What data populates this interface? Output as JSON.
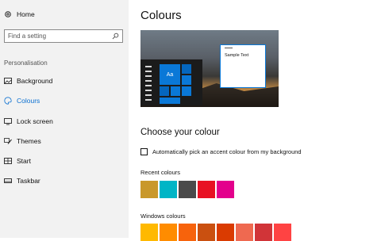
{
  "sidebar": {
    "home_label": "Home",
    "search_placeholder": "Find a setting",
    "section_label": "Personalisation",
    "items": [
      {
        "label": "Background",
        "icon": "picture-icon",
        "active": false
      },
      {
        "label": "Colours",
        "icon": "palette-icon",
        "active": true
      },
      {
        "label": "Lock screen",
        "icon": "monitor-icon",
        "active": false
      },
      {
        "label": "Themes",
        "icon": "brush-icon",
        "active": false
      },
      {
        "label": "Start",
        "icon": "start-tiles-icon",
        "active": false
      },
      {
        "label": "Taskbar",
        "icon": "taskbar-icon",
        "active": false
      }
    ]
  },
  "main": {
    "title": "Colours",
    "preview_sample_text": "Sample Text",
    "preview_tile_text": "Aa",
    "choose_title": "Choose your colour",
    "auto_accent_label": "Automatically pick an accent colour from my background",
    "auto_accent_checked": false,
    "recent_label": "Recent colours",
    "recent_colours": [
      "#c9982a",
      "#00b5c6",
      "#4a4a4a",
      "#e81123",
      "#e3008c"
    ],
    "windows_label": "Windows colours",
    "windows_colours": [
      "#ffb900",
      "#ff8c00",
      "#f7630c",
      "#ca5010",
      "#da3b01",
      "#ef6950",
      "#d13438",
      "#ff4343"
    ]
  },
  "colors": {
    "accent": "#0a6fd0",
    "sidebar_bg": "#f2f2f2"
  }
}
